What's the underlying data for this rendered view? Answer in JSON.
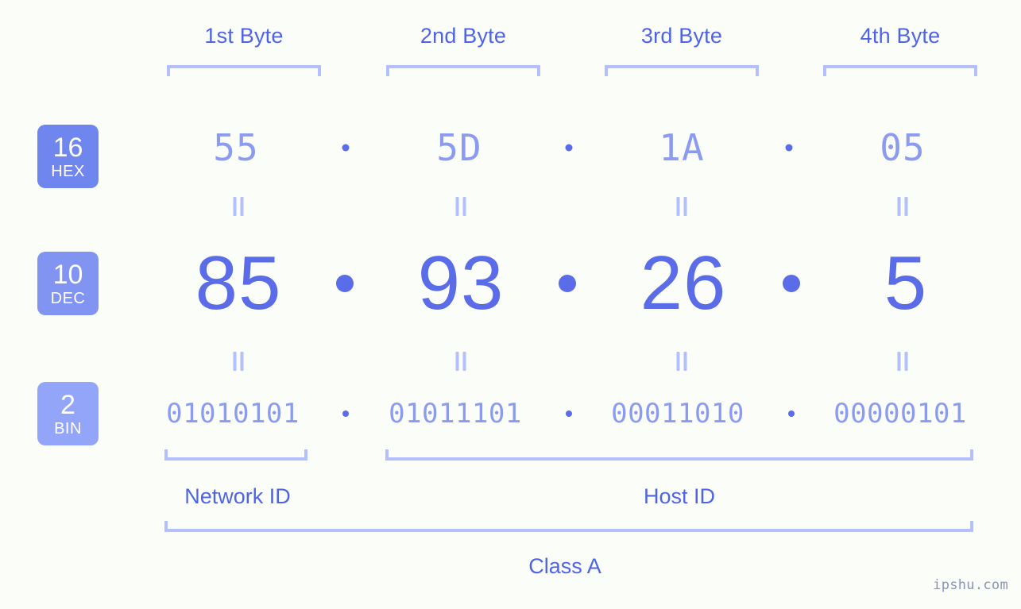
{
  "background_color": "#fbfdf8",
  "accent_strong": "#5a6ce8",
  "accent_light": "#8b9cf0",
  "bracket_color": "#b3c0fb",
  "byte_headers": [
    {
      "label": "1st Byte"
    },
    {
      "label": "2nd Byte"
    },
    {
      "label": "3rd Byte"
    },
    {
      "label": "4th Byte"
    }
  ],
  "bases": [
    {
      "number": "16",
      "name": "HEX",
      "color": "#7086ef"
    },
    {
      "number": "10",
      "name": "DEC",
      "color": "#8294f2"
    },
    {
      "number": "2",
      "name": "BIN",
      "color": "#93a5f9"
    }
  ],
  "rows": {
    "hex": {
      "base": "16",
      "values": [
        "55",
        "5D",
        "1A",
        "05"
      ],
      "separator": "."
    },
    "dec": {
      "base": "10",
      "values": [
        "85",
        "93",
        "26",
        "5"
      ],
      "separator": "."
    },
    "bin": {
      "base": "2",
      "values": [
        "01010101",
        "01011101",
        "00011010",
        "00000101"
      ],
      "separator": "."
    }
  },
  "equality_symbol": "=",
  "sections": {
    "network_id": "Network ID",
    "host_id": "Host ID",
    "class": "Class A"
  },
  "watermark": "ipshu.com",
  "chart_data": {
    "type": "table",
    "title": "IP Address 85.93.26.5 byte breakdown",
    "ip_address_decimal": "85.93.26.5",
    "ip_address_hex": "55.5D.1A.05",
    "ip_address_binary": "01010101.01011101.00011010.00000101",
    "ip_class": "Class A",
    "network_id_bytes": 1,
    "host_id_bytes": 3,
    "columns": [
      "1st Byte",
      "2nd Byte",
      "3rd Byte",
      "4th Byte"
    ],
    "rows": [
      {
        "base": "16",
        "name": "HEX",
        "values": [
          "55",
          "5D",
          "1A",
          "05"
        ]
      },
      {
        "base": "10",
        "name": "DEC",
        "values": [
          "85",
          "93",
          "26",
          "5"
        ]
      },
      {
        "base": "2",
        "name": "BIN",
        "values": [
          "01010101",
          "01011101",
          "00011010",
          "00000101"
        ]
      }
    ]
  }
}
